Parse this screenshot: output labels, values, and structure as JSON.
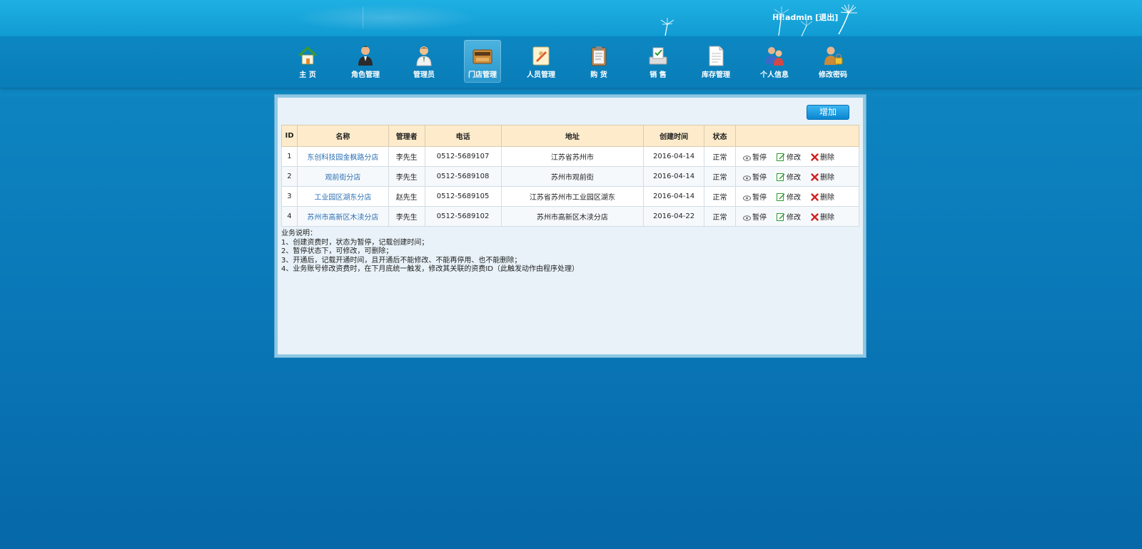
{
  "header": {
    "greeting": "Hi!",
    "username": "admin",
    "logout": "[退出]"
  },
  "nav": [
    {
      "label": "主 页",
      "icon": "home-icon"
    },
    {
      "label": "角色管理",
      "icon": "role-icon"
    },
    {
      "label": "管理员",
      "icon": "admin-icon"
    },
    {
      "label": "门店管理",
      "icon": "store-icon",
      "active": true
    },
    {
      "label": "人员管理",
      "icon": "staff-icon"
    },
    {
      "label": "购 货",
      "icon": "purchase-icon"
    },
    {
      "label": "销 售",
      "icon": "sales-icon"
    },
    {
      "label": "库存管理",
      "icon": "inventory-icon"
    },
    {
      "label": "个人信息",
      "icon": "profile-icon"
    },
    {
      "label": "修改密码",
      "icon": "password-icon"
    }
  ],
  "toolbar": {
    "add_label": "增加"
  },
  "table": {
    "headers": [
      "ID",
      "名称",
      "管理者",
      "电话",
      "地址",
      "创建时间",
      "状态",
      ""
    ],
    "rows": [
      {
        "id": "1",
        "name": "东创科技园金枫路分店",
        "manager": "李先生",
        "phone": "0512-5689107",
        "address": "江苏省苏州市",
        "created": "2016-04-14",
        "status": "正常"
      },
      {
        "id": "2",
        "name": "观前街分店",
        "manager": "李先生",
        "phone": "0512-5689108",
        "address": "苏州市观前街",
        "created": "2016-04-14",
        "status": "正常"
      },
      {
        "id": "3",
        "name": "工业园区湖东分店",
        "manager": "赵先生",
        "phone": "0512-5689105",
        "address": "江苏省苏州市工业园区湖东",
        "created": "2016-04-14",
        "status": "正常"
      },
      {
        "id": "4",
        "name": "苏州市高新区木渎分店",
        "manager": "李先生",
        "phone": "0512-5689102",
        "address": "苏州市高新区木渎分店",
        "created": "2016-04-22",
        "status": "正常"
      }
    ],
    "actions": {
      "pause": "暂停",
      "edit": "修改",
      "delete": "删除"
    }
  },
  "notes": [
    "业务说明：",
    "1、创建资费时，状态为暂停，记载创建时间；",
    "2、暂停状态下，可修改，可删除；",
    "3、开通后，记载开通时间，且开通后不能修改、不能再停用、也不能删除；",
    "4、业务账号修改资费时，在下月底统一触发，修改其关联的资费ID（此触发动作由程序处理）"
  ],
  "colors": {
    "header_bg": "#1aa6d9",
    "nav_bg": "#0c87c2",
    "table_header_bg": "#fdebcb",
    "link": "#2a6fb3",
    "delete": "#d42020",
    "edit": "#2e9a2e"
  }
}
